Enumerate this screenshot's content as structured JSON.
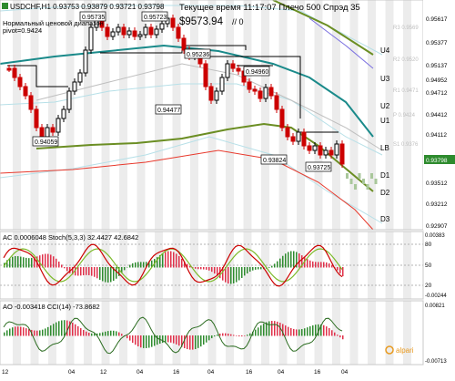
{
  "header": {
    "symbol_ohlc": "USDCHF,H1  0.93753 0.93879 0.93721 0.93798",
    "indicator_line1": "Нормальный ценовой диапазон",
    "indicator_line2": "pivot=0.9424",
    "server_time": "Текущее время 11:17:07  Плечо 500  Спрэд 35",
    "balance": "$9573.94",
    "balance_suffix": "// 0"
  },
  "price_scale": [
    {
      "label": "0.95617",
      "highlight": false
    },
    {
      "label": "0.95377",
      "highlight": false
    },
    {
      "label": "0.95137",
      "highlight": false
    },
    {
      "label": "0.94952",
      "highlight": false
    },
    {
      "label": "0.94712",
      "highlight": false
    },
    {
      "label": "0.94412",
      "highlight": false
    },
    {
      "label": "0.94112",
      "highlight": false
    },
    {
      "label": "0.93798",
      "highlight": true
    },
    {
      "label": "0.93512",
      "highlight": false
    },
    {
      "label": "0.93212",
      "highlight": false
    },
    {
      "label": "0.92907",
      "highlight": false
    }
  ],
  "level_labels": [
    "U4",
    "U3",
    "U2",
    "U1",
    "LB",
    "D1",
    "D2",
    "D3"
  ],
  "faint_level_labels": [
    "R3 0.9569",
    "R2 0.9520",
    "R1 0.9471",
    "P 0.9424",
    "S1 0.9376"
  ],
  "price_annotations": [
    "0.95735",
    "0.95723",
    "0.95236",
    "0.94960",
    "0.94477",
    "0.94059",
    "0.93824",
    "0.93725"
  ],
  "stoch_pane": {
    "caption": "AC 0.0006048   Stoch(5,3,3) 32.4427 42.6842",
    "scale": [
      "0.00383",
      "80",
      "50",
      "20",
      "-0.00244"
    ]
  },
  "cci_pane": {
    "caption": "AO -0.003418   CCI(14) -73.8682",
    "scale": [
      "0.00821",
      "-0.00713"
    ]
  },
  "time_axis": [
    "12",
    "04",
    "12",
    "04",
    "16",
    "04",
    "16",
    "04",
    "16",
    "04"
  ],
  "watermark": "alpari",
  "colors": {
    "bull_candle": "#000000",
    "bear_candle": "#cc0000",
    "teal_ma": "#1a8a8a",
    "olive_ma": "#6b8e23",
    "red_band": "#e8392c",
    "stoch_main": "#cc0000",
    "stoch_signal": "#7cba2a",
    "ac_up": "#2e8b2e",
    "ac_down": "#e0304a",
    "price_tag": "#2e8b2e"
  }
}
